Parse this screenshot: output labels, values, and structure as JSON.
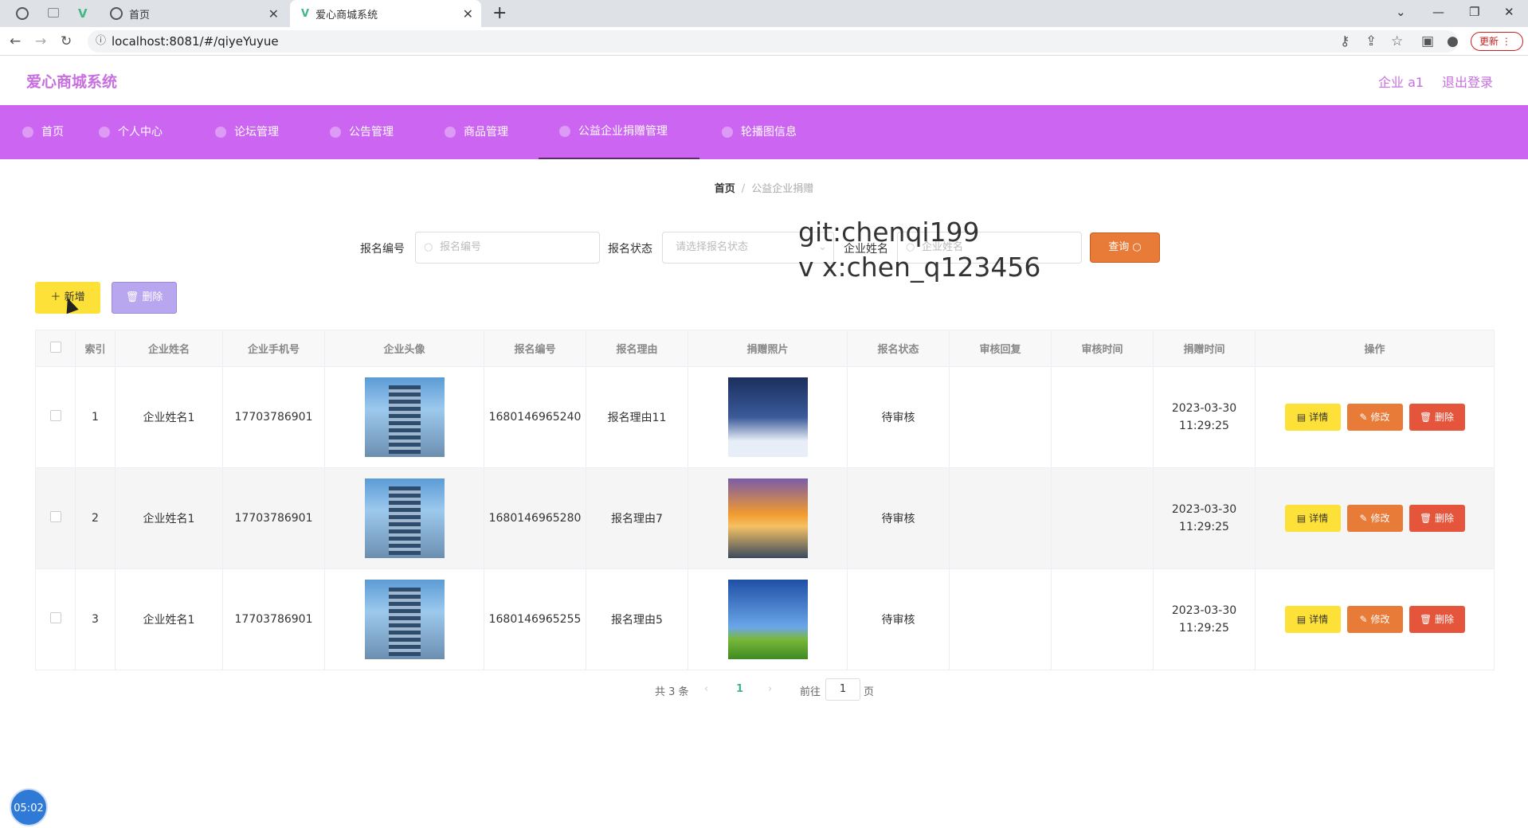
{
  "browser": {
    "tabs": [
      {
        "label": "首页"
      },
      {
        "label": "爱心商城系统"
      }
    ],
    "new_tab": "+",
    "url": "localhost:8081/#/qiyeYuyue",
    "update_label": "更新"
  },
  "header": {
    "logo": "爱心商城系统",
    "user": "企业 a1",
    "logout": "退出登录"
  },
  "menu": [
    {
      "label": "首页"
    },
    {
      "label": "个人中心"
    },
    {
      "label": "论坛管理"
    },
    {
      "label": "公告管理"
    },
    {
      "label": "商品管理"
    },
    {
      "label": "公益企业捐赠管理"
    },
    {
      "label": "轮播图信息"
    }
  ],
  "breadcrumb": {
    "home": "首页",
    "current": "公益企业捐赠"
  },
  "search": {
    "field1_label": "报名编号",
    "field1_placeholder": "报名编号",
    "field2_label": "报名状态",
    "field2_placeholder": "请选择报名状态",
    "field3_label": "企业姓名",
    "field3_placeholder": "企业姓名",
    "query_label": "查询"
  },
  "watermark": {
    "line1": "git:chenqi199",
    "line2": "v x:chen_q123456"
  },
  "actions": {
    "add": "新增",
    "delete": "删除"
  },
  "table": {
    "headers": [
      "索引",
      "企业姓名",
      "企业手机号",
      "企业头像",
      "报名编号",
      "报名理由",
      "捐赠照片",
      "报名状态",
      "审核回复",
      "审核时间",
      "捐赠时间",
      "操作"
    ],
    "rows": [
      {
        "index": "1",
        "name": "企业姓名1",
        "phone": "17703786901",
        "number": "1680146965240",
        "reason": "报名理由11",
        "status": "待审核",
        "reply": "",
        "audit_time": "",
        "donate_time": "2023-03-30 11:29:25",
        "photo": "snow"
      },
      {
        "index": "2",
        "name": "企业姓名1",
        "phone": "17703786901",
        "number": "1680146965280",
        "reason": "报名理由7",
        "status": "待审核",
        "reply": "",
        "audit_time": "",
        "donate_time": "2023-03-30 11:29:25",
        "photo": "sunset"
      },
      {
        "index": "3",
        "name": "企业姓名1",
        "phone": "17703786901",
        "number": "1680146965255",
        "reason": "报名理由5",
        "status": "待审核",
        "reply": "",
        "audit_time": "",
        "donate_time": "2023-03-30 11:29:25",
        "photo": "meadow"
      }
    ],
    "row_actions": {
      "detail": "详情",
      "edit": "修改",
      "delete": "删除"
    }
  },
  "pager": {
    "total": "共 3 条",
    "current": "1",
    "goto": "前往",
    "page_value": "1",
    "page_suffix": "页"
  },
  "timer": "05:02"
}
